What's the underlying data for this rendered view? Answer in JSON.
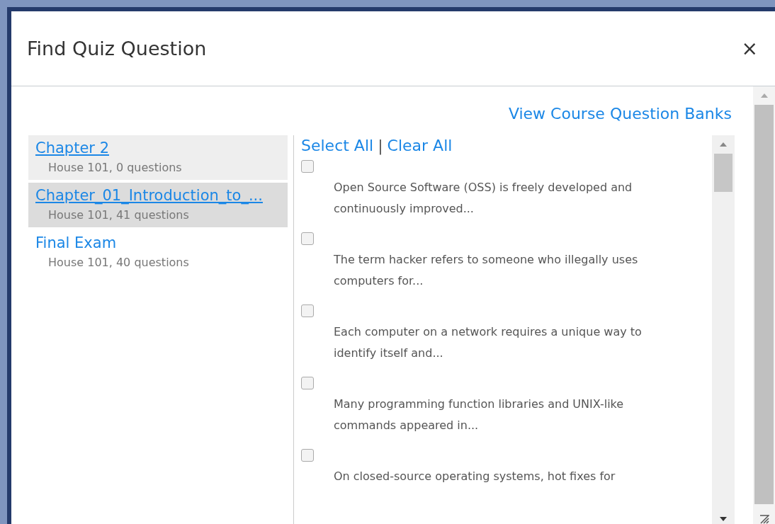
{
  "dialog": {
    "title": "Find Quiz Question",
    "close": "×"
  },
  "bank_link": "View Course Question Banks",
  "banks": [
    {
      "name": "Chapter 2",
      "details": "House 101, 0 questions",
      "selected": false,
      "hovered": true
    },
    {
      "name": "Chapter_01_Introduction_to_...",
      "details": "House 101, 41 questions",
      "selected": true,
      "hovered": false
    },
    {
      "name": "Final Exam",
      "details": "House 101, 40 questions",
      "selected": false,
      "hovered": false
    }
  ],
  "select_all": "Select All",
  "separator": "|",
  "clear_all": "Clear All",
  "questions": [
    {
      "text": "Open Source Software (OSS) is freely developed and continuously improved...",
      "checked": false
    },
    {
      "text": "The term hacker refers to someone who illegally uses computers for...",
      "checked": false
    },
    {
      "text": "Each computer on a network requires a unique way to identify itself and...",
      "checked": false
    },
    {
      "text": "Many programming function libraries and UNIX-like commands appeared in...",
      "checked": false
    },
    {
      "text": "On closed-source operating systems, hot fixes for",
      "checked": false
    }
  ]
}
